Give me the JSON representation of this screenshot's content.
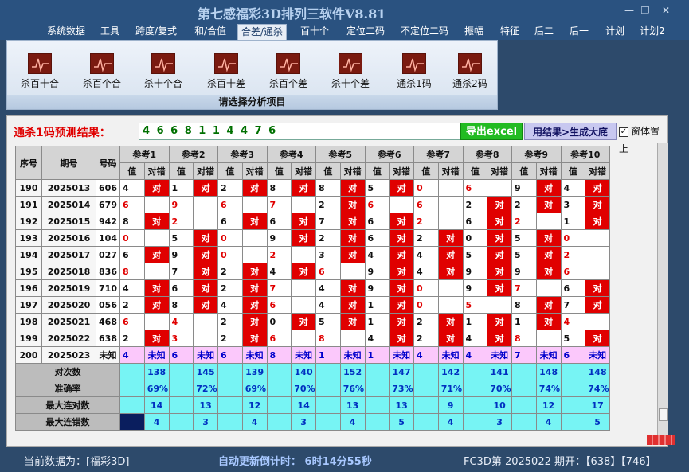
{
  "app_title": "第七感福彩3D排列三软件V8.81",
  "window_buttons": {
    "minimize": "—",
    "restore": "❐",
    "close": "✕"
  },
  "menu": [
    "系统数据",
    "工具",
    "跨度/复式",
    "和/合值",
    "合差/通杀",
    "百十个",
    "定位二码",
    "不定位二码",
    "振幅",
    "特征",
    "后二",
    "后一",
    "计划",
    "计划2"
  ],
  "active_menu": "合差/通杀",
  "ribbon": {
    "buttons": [
      "杀百十合",
      "杀百个合",
      "杀十个合",
      "杀百十差",
      "杀百个差",
      "杀十个差",
      "通杀1码",
      "通杀2码"
    ],
    "caption": "请选择分析项目"
  },
  "result": {
    "label": "通杀1码预测结果：",
    "value": "4 6 6 8 1 1 4 4 7 6",
    "export_label": "导出excel",
    "generate_label": "用结果>生成大底",
    "pin_label": "窗体置上",
    "pin_checked": true
  },
  "table": {
    "col_index": "序号",
    "col_period": "期号",
    "col_number": "号码",
    "ref_headers": [
      "参考1",
      "参考2",
      "参考3",
      "参考4",
      "参考5",
      "参考6",
      "参考7",
      "参考8",
      "参考9",
      "参考10"
    ],
    "sub_value": "值",
    "sub_result": "对错",
    "hit_text": "对",
    "rows": [
      {
        "idx": "190",
        "period": "2025013",
        "num": "606",
        "refs": [
          [
            "4",
            1,
            0
          ],
          [
            "1",
            1,
            0
          ],
          [
            "2",
            1,
            0
          ],
          [
            "8",
            1,
            0
          ],
          [
            "8",
            1,
            0
          ],
          [
            "5",
            1,
            0
          ],
          [
            "0",
            0,
            1
          ],
          [
            "6",
            0,
            1
          ],
          [
            "9",
            1,
            0
          ],
          [
            "4",
            1,
            0
          ]
        ]
      },
      {
        "idx": "191",
        "period": "2025014",
        "num": "679",
        "refs": [
          [
            "6",
            0,
            1
          ],
          [
            "9",
            0,
            1
          ],
          [
            "6",
            0,
            1
          ],
          [
            "7",
            0,
            1
          ],
          [
            "2",
            1,
            0
          ],
          [
            "6",
            0,
            1
          ],
          [
            "6",
            0,
            1
          ],
          [
            "2",
            1,
            0
          ],
          [
            "2",
            1,
            0
          ],
          [
            "3",
            1,
            0
          ]
        ]
      },
      {
        "idx": "192",
        "period": "2025015",
        "num": "942",
        "refs": [
          [
            "8",
            1,
            0
          ],
          [
            "2",
            0,
            1
          ],
          [
            "6",
            1,
            0
          ],
          [
            "6",
            1,
            0
          ],
          [
            "7",
            1,
            0
          ],
          [
            "6",
            1,
            0
          ],
          [
            "2",
            0,
            1
          ],
          [
            "6",
            1,
            0
          ],
          [
            "2",
            0,
            1
          ],
          [
            "1",
            1,
            0
          ]
        ]
      },
      {
        "idx": "193",
        "period": "2025016",
        "num": "104",
        "refs": [
          [
            "0",
            0,
            1
          ],
          [
            "5",
            1,
            0
          ],
          [
            "0",
            0,
            1
          ],
          [
            "9",
            1,
            0
          ],
          [
            "2",
            1,
            0
          ],
          [
            "6",
            1,
            0
          ],
          [
            "2",
            1,
            0
          ],
          [
            "0",
            1,
            0
          ],
          [
            "5",
            1,
            0
          ],
          [
            "0",
            0,
            1
          ]
        ]
      },
      {
        "idx": "194",
        "period": "2025017",
        "num": "027",
        "refs": [
          [
            "6",
            1,
            0
          ],
          [
            "9",
            1,
            0
          ],
          [
            "0",
            0,
            1
          ],
          [
            "2",
            0,
            1
          ],
          [
            "3",
            1,
            0
          ],
          [
            "4",
            1,
            0
          ],
          [
            "4",
            1,
            0
          ],
          [
            "5",
            1,
            0
          ],
          [
            "5",
            1,
            0
          ],
          [
            "2",
            0,
            1
          ]
        ]
      },
      {
        "idx": "195",
        "period": "2025018",
        "num": "836",
        "refs": [
          [
            "8",
            0,
            1
          ],
          [
            "7",
            1,
            0
          ],
          [
            "2",
            1,
            0
          ],
          [
            "4",
            1,
            0
          ],
          [
            "6",
            0,
            1
          ],
          [
            "9",
            1,
            0
          ],
          [
            "4",
            1,
            0
          ],
          [
            "9",
            1,
            0
          ],
          [
            "9",
            1,
            0
          ],
          [
            "6",
            0,
            1
          ]
        ]
      },
      {
        "idx": "196",
        "period": "2025019",
        "num": "710",
        "refs": [
          [
            "4",
            1,
            0
          ],
          [
            "6",
            1,
            0
          ],
          [
            "2",
            1,
            0
          ],
          [
            "7",
            0,
            1
          ],
          [
            "4",
            1,
            0
          ],
          [
            "9",
            1,
            0
          ],
          [
            "0",
            0,
            1
          ],
          [
            "9",
            1,
            0
          ],
          [
            "7",
            0,
            1
          ],
          [
            "6",
            1,
            0
          ]
        ]
      },
      {
        "idx": "197",
        "period": "2025020",
        "num": "056",
        "refs": [
          [
            "2",
            1,
            0
          ],
          [
            "8",
            1,
            0
          ],
          [
            "4",
            1,
            0
          ],
          [
            "6",
            0,
            1
          ],
          [
            "4",
            1,
            0
          ],
          [
            "1",
            1,
            0
          ],
          [
            "0",
            0,
            1
          ],
          [
            "5",
            0,
            1
          ],
          [
            "8",
            1,
            0
          ],
          [
            "7",
            1,
            0
          ]
        ]
      },
      {
        "idx": "198",
        "period": "2025021",
        "num": "468",
        "refs": [
          [
            "6",
            0,
            1
          ],
          [
            "4",
            0,
            1
          ],
          [
            "2",
            1,
            0
          ],
          [
            "0",
            1,
            0
          ],
          [
            "5",
            1,
            0
          ],
          [
            "1",
            1,
            0
          ],
          [
            "2",
            1,
            0
          ],
          [
            "1",
            1,
            0
          ],
          [
            "1",
            1,
            0
          ],
          [
            "4",
            0,
            1
          ]
        ]
      },
      {
        "idx": "199",
        "period": "2025022",
        "num": "638",
        "refs": [
          [
            "2",
            1,
            0
          ],
          [
            "3",
            0,
            1
          ],
          [
            "2",
            1,
            0
          ],
          [
            "6",
            0,
            1
          ],
          [
            "8",
            0,
            1
          ],
          [
            "4",
            1,
            0
          ],
          [
            "2",
            1,
            0
          ],
          [
            "4",
            1,
            0
          ],
          [
            "8",
            0,
            1
          ],
          [
            "5",
            1,
            0
          ]
        ]
      },
      {
        "idx": "200",
        "period": "2025023",
        "num": "未知",
        "refs": [
          [
            "4",
            0,
            0
          ],
          [
            "6",
            0,
            0
          ],
          [
            "6",
            0,
            0
          ],
          [
            "8",
            0,
            0
          ],
          [
            "1",
            0,
            0
          ],
          [
            "1",
            0,
            0
          ],
          [
            "4",
            0,
            0
          ],
          [
            "4",
            0,
            0
          ],
          [
            "7",
            0,
            0
          ],
          [
            "6",
            0,
            0
          ]
        ]
      }
    ],
    "unknown_text": "未知",
    "stats": [
      {
        "label": "对次数",
        "values": [
          "138",
          "145",
          "139",
          "140",
          "152",
          "147",
          "142",
          "141",
          "148",
          "148"
        ]
      },
      {
        "label": "准确率",
        "values": [
          "69%",
          "72%",
          "69%",
          "70%",
          "76%",
          "73%",
          "71%",
          "70%",
          "74%",
          "74%"
        ]
      },
      {
        "label": "最大连对数",
        "values": [
          "14",
          "13",
          "12",
          "14",
          "13",
          "13",
          "9",
          "10",
          "12",
          "17"
        ]
      },
      {
        "label": "最大连错数",
        "values": [
          "4",
          "3",
          "4",
          "3",
          "4",
          "5",
          "4",
          "3",
          "4",
          "5"
        ]
      }
    ]
  },
  "status": {
    "left": "当前数据为：[福彩3D]",
    "countdown": "自动更新倒计时： 6时14分55秒",
    "right": "FC3D第 2025022 期开：【638】【746】"
  }
}
